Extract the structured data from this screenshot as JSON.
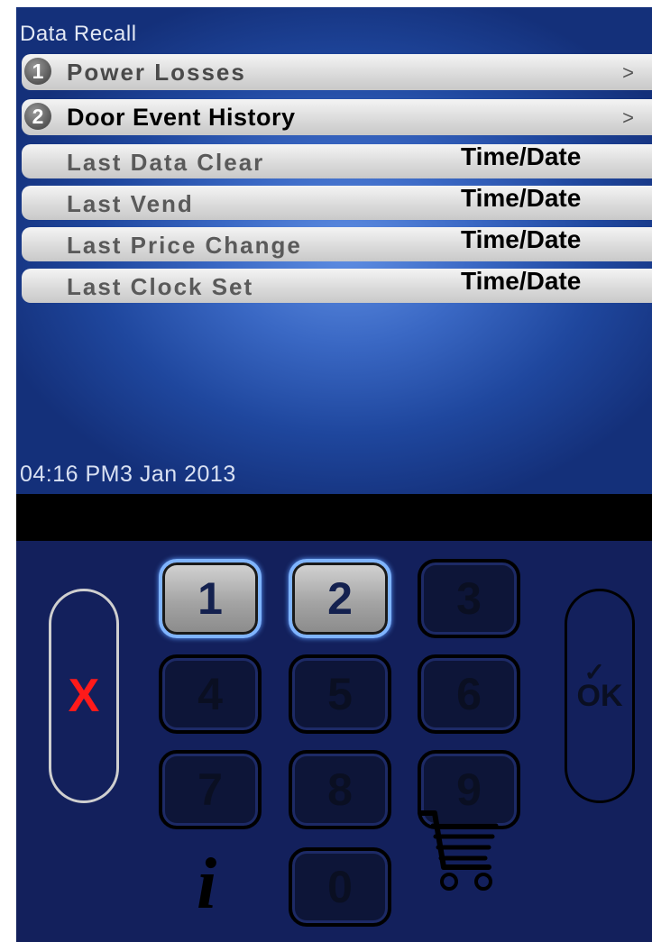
{
  "screen": {
    "title": "Data Recall",
    "menu": [
      {
        "num": "1",
        "label": "Power Losses",
        "chevron": ">"
      },
      {
        "num": "2",
        "label": "Door Event History",
        "chevron": ">"
      }
    ],
    "info_rows": [
      {
        "label": "Last Data Clear",
        "value": "Time/Date"
      },
      {
        "label": "Last Vend",
        "value": "Time/Date"
      },
      {
        "label": "Last Price Change",
        "value": "Time/Date"
      },
      {
        "label": "Last Clock Set",
        "value": "Time/Date"
      }
    ],
    "clock": "04:16 PM",
    "date": "3 Jan 2013"
  },
  "keypad": {
    "keys": [
      "1",
      "2",
      "3",
      "4",
      "5",
      "6",
      "7",
      "8",
      "9",
      "0"
    ],
    "active_keys": [
      "1",
      "2"
    ],
    "cancel_label": "X",
    "ok_label": "OK",
    "info_label": "i",
    "icons": {
      "cancel": "x-icon",
      "ok": "checkmark-icon",
      "info": "info-icon",
      "cart": "shopping-cart-icon"
    }
  },
  "colors": {
    "screen_bg": "#3a68c4",
    "keypad_bg": "#13205c",
    "cancel": "#ff1a1a",
    "active_key_border": "#7fb4ff"
  }
}
